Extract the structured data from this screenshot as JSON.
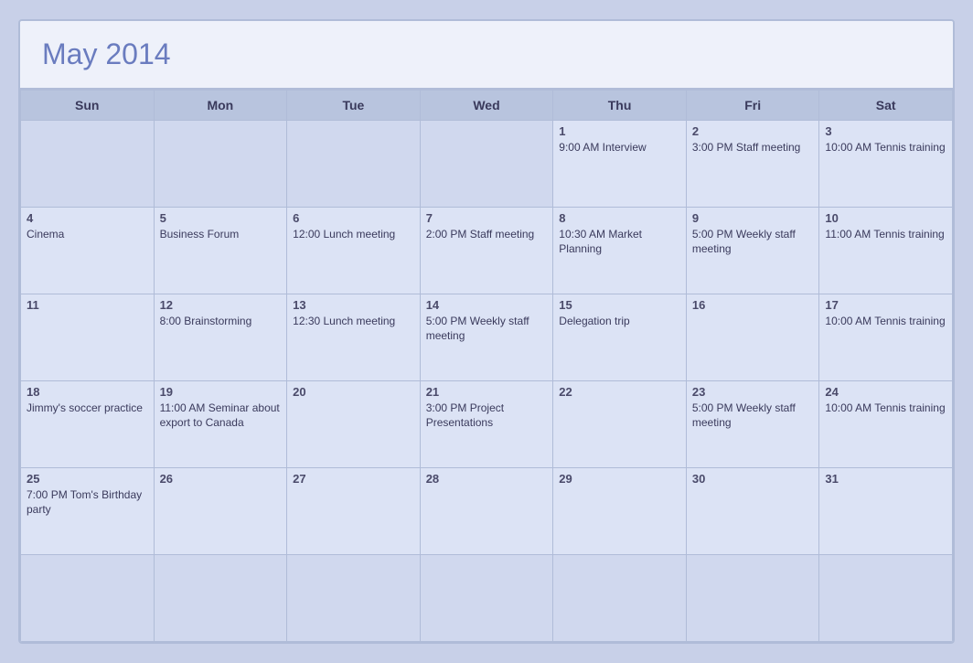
{
  "title": "May 2014",
  "headers": [
    "Sun",
    "Mon",
    "Tue",
    "Wed",
    "Thu",
    "Fri",
    "Sat"
  ],
  "weeks": [
    [
      {
        "day": "",
        "event": ""
      },
      {
        "day": "",
        "event": ""
      },
      {
        "day": "",
        "event": ""
      },
      {
        "day": "",
        "event": ""
      },
      {
        "day": "1",
        "event": "9:00 AM Interview"
      },
      {
        "day": "2",
        "event": "3:00 PM Staff meeting"
      },
      {
        "day": "3",
        "event": "10:00 AM Tennis training"
      }
    ],
    [
      {
        "day": "4",
        "event": "Cinema"
      },
      {
        "day": "5",
        "event": "Business Forum"
      },
      {
        "day": "6",
        "event": "12:00 Lunch meeting"
      },
      {
        "day": "7",
        "event": "2:00 PM Staff meeting"
      },
      {
        "day": "8",
        "event": "10:30 AM Market Planning"
      },
      {
        "day": "9",
        "event": "5:00 PM Weekly staff meeting"
      },
      {
        "day": "10",
        "event": "11:00 AM Tennis training"
      }
    ],
    [
      {
        "day": "11",
        "event": ""
      },
      {
        "day": "12",
        "event": "8:00 Brainstorming"
      },
      {
        "day": "13",
        "event": "12:30 Lunch meeting"
      },
      {
        "day": "14",
        "event": "5:00 PM Weekly staff meeting"
      },
      {
        "day": "15",
        "event": "Delegation trip"
      },
      {
        "day": "16",
        "event": ""
      },
      {
        "day": "17",
        "event": "10:00 AM Tennis training"
      }
    ],
    [
      {
        "day": "18",
        "event": "Jimmy's soccer practice"
      },
      {
        "day": "19",
        "event": "11:00 AM Seminar about export to Canada"
      },
      {
        "day": "20",
        "event": ""
      },
      {
        "day": "21",
        "event": "3:00 PM Project Presentations"
      },
      {
        "day": "22",
        "event": ""
      },
      {
        "day": "23",
        "event": "5:00 PM Weekly staff meeting"
      },
      {
        "day": "24",
        "event": "10:00 AM Tennis training"
      }
    ],
    [
      {
        "day": "25",
        "event": "7:00 PM Tom's Birthday party"
      },
      {
        "day": "26",
        "event": ""
      },
      {
        "day": "27",
        "event": ""
      },
      {
        "day": "28",
        "event": ""
      },
      {
        "day": "29",
        "event": ""
      },
      {
        "day": "30",
        "event": ""
      },
      {
        "day": "31",
        "event": ""
      }
    ],
    [
      {
        "day": "",
        "event": ""
      },
      {
        "day": "",
        "event": ""
      },
      {
        "day": "",
        "event": ""
      },
      {
        "day": "",
        "event": ""
      },
      {
        "day": "",
        "event": ""
      },
      {
        "day": "",
        "event": ""
      },
      {
        "day": "",
        "event": ""
      }
    ]
  ]
}
